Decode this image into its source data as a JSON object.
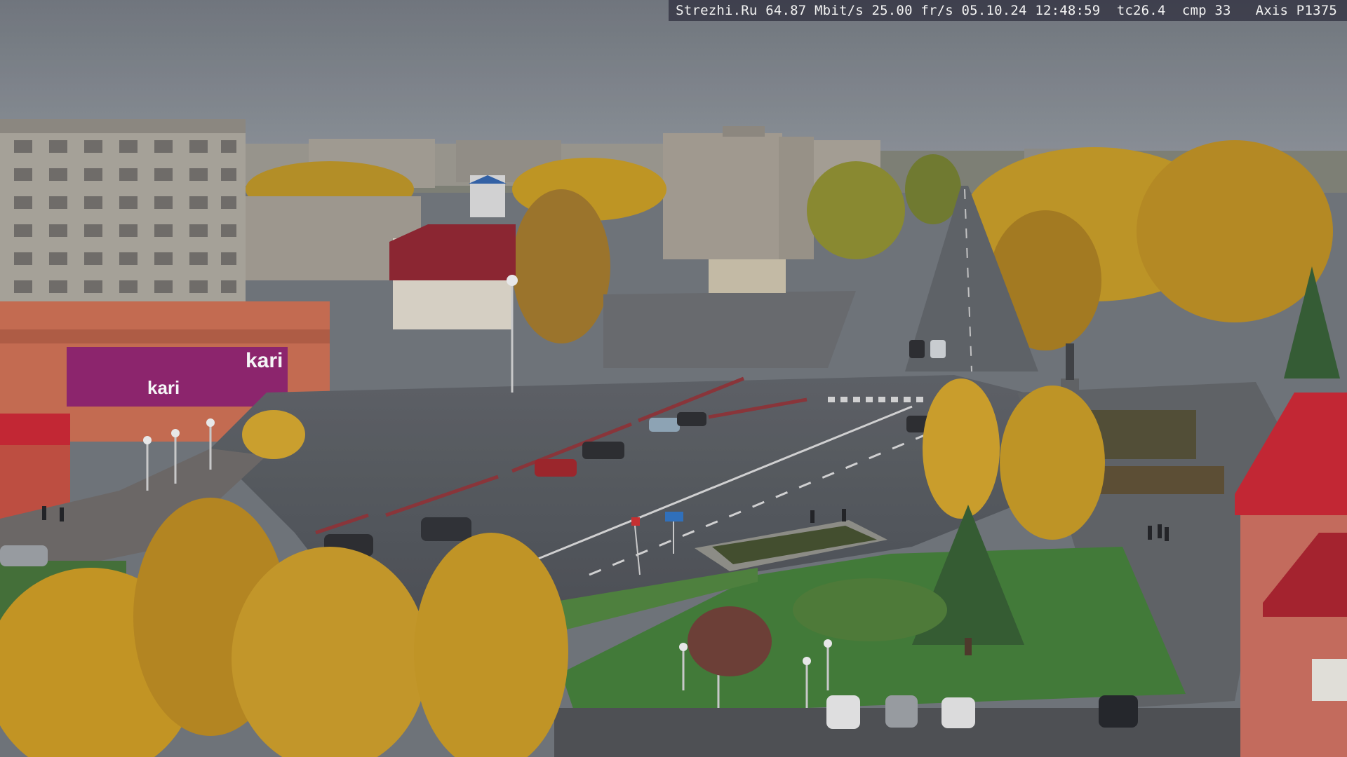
{
  "osd": {
    "site": "Strezhi.Ru",
    "bitrate": "64.87 Mbit/s",
    "framerate": "25.00 fr/s",
    "date": "05.10.24",
    "time": "12:48:59",
    "tc": "tc26.4",
    "cmp": "cmp 33",
    "camera": "Axis P1375"
  },
  "signs": {
    "store_logo": "kari",
    "store_logo_2": "kari"
  },
  "colors": {
    "sky": "#7a8087",
    "asphalt": "#4e5257",
    "birch_yellow": "#c9961f",
    "grass": "#3f7a34",
    "kari_magenta": "#8e1e6b",
    "roof_red": "#c8202d"
  }
}
